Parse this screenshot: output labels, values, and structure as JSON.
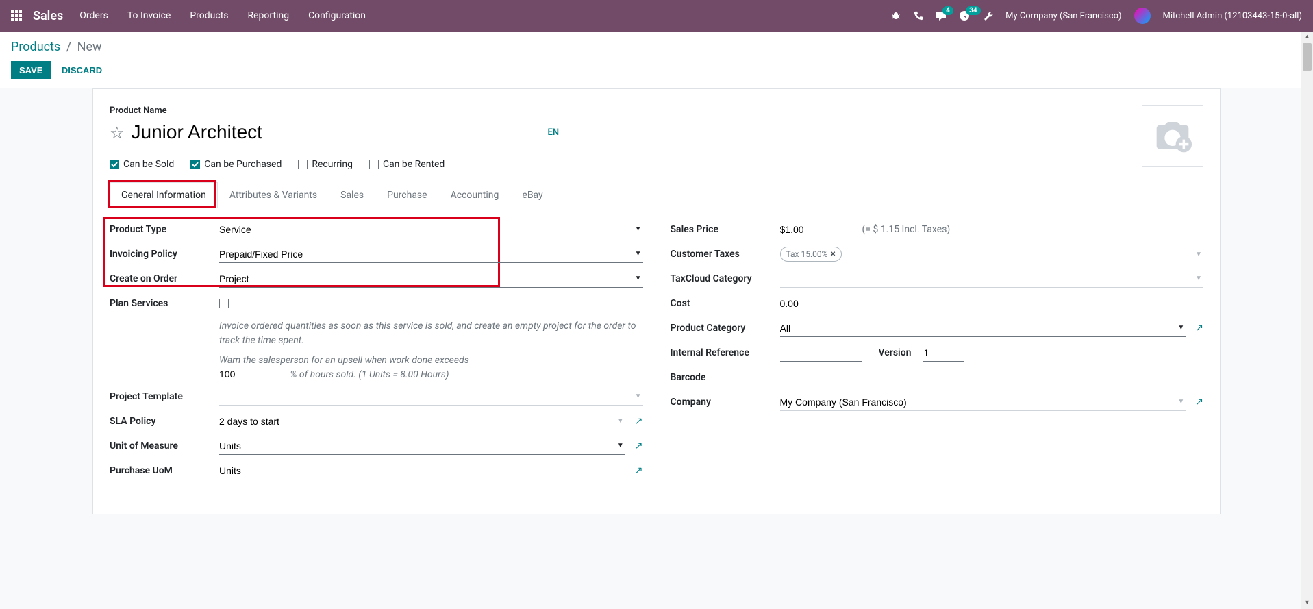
{
  "topbar": {
    "brand": "Sales",
    "menu": [
      "Orders",
      "To Invoice",
      "Products",
      "Reporting",
      "Configuration"
    ],
    "msg_badge": "4",
    "activity_badge": "34",
    "company": "My Company (San Francisco)",
    "user": "Mitchell Admin (12103443-15-0-all)"
  },
  "breadcrumb": {
    "root": "Products",
    "current": "New"
  },
  "buttons": {
    "save": "SAVE",
    "discard": "DISCARD"
  },
  "product": {
    "name_label": "Product Name",
    "name": "Junior Architect",
    "lang": "EN",
    "checks": {
      "sold": "Can be Sold",
      "purchased": "Can be Purchased",
      "recurring": "Recurring",
      "rented": "Can be Rented"
    }
  },
  "tabs": [
    "General Information",
    "Attributes & Variants",
    "Sales",
    "Purchase",
    "Accounting",
    "eBay"
  ],
  "left": {
    "product_type_lbl": "Product Type",
    "product_type": "Service",
    "invoicing_lbl": "Invoicing Policy",
    "invoicing": "Prepaid/Fixed Price",
    "create_lbl": "Create on Order",
    "create": "Project",
    "plan_lbl": "Plan Services",
    "help1": "Invoice ordered quantities as soon as this service is sold, and create an empty project for the order to track the time spent.",
    "help2a": "Warn the salesperson for an upsell when work done exceeds",
    "upsell_pct": "100",
    "help2b": "% of hours sold. (1 Units = 8.00 Hours)",
    "proj_tmpl_lbl": "Project Template",
    "sla_lbl": "SLA Policy",
    "sla": "2 days to start",
    "uom_lbl": "Unit of Measure",
    "uom": "Units",
    "puom_lbl": "Purchase UoM",
    "puom": "Units"
  },
  "right": {
    "price_lbl": "Sales Price",
    "price": "$1.00",
    "price_note": "(= $ 1.15 Incl. Taxes)",
    "ctax_lbl": "Customer Taxes",
    "ctax": "Tax 15.00%",
    "tcloud_lbl": "TaxCloud Category",
    "cost_lbl": "Cost",
    "cost": "0.00",
    "cat_lbl": "Product Category",
    "cat": "All",
    "ref_lbl": "Internal Reference",
    "ver_lbl": "Version",
    "ver": "1",
    "barcode_lbl": "Barcode",
    "company_lbl": "Company",
    "company": "My Company (San Francisco)"
  }
}
